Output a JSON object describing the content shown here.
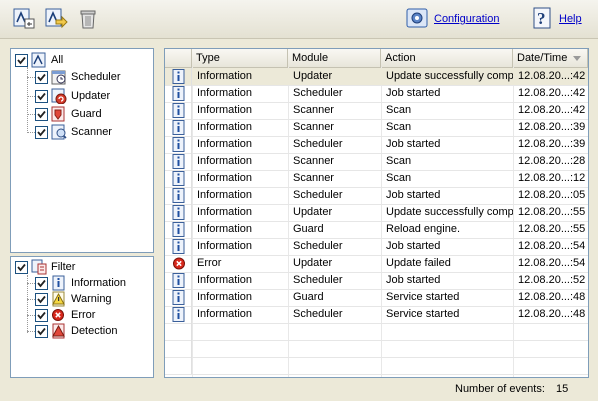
{
  "toolbar": {
    "buttons": [
      {
        "name": "export-log-icon"
      },
      {
        "name": "open-log-icon"
      },
      {
        "name": "delete-log-icon"
      }
    ],
    "configuration_label": "Configuration",
    "help_label": "Help"
  },
  "modules_tree": {
    "root_label": "All",
    "items": [
      {
        "label": "Scheduler",
        "icon": "scheduler-icon"
      },
      {
        "label": "Updater",
        "icon": "updater-icon"
      },
      {
        "label": "Guard",
        "icon": "guard-icon"
      },
      {
        "label": "Scanner",
        "icon": "scanner-icon"
      }
    ]
  },
  "filter_tree": {
    "root_label": "Filter",
    "items": [
      {
        "label": "Information",
        "icon": "information-icon"
      },
      {
        "label": "Warning",
        "icon": "warning-icon"
      },
      {
        "label": "Error",
        "icon": "error-icon"
      },
      {
        "label": "Detection",
        "icon": "detection-icon"
      }
    ]
  },
  "table": {
    "columns": [
      "Type",
      "Module",
      "Action",
      "Date/Time"
    ],
    "rows": [
      {
        "type": "Information",
        "module": "Updater",
        "action": "Update successfully compl",
        "datetime": "12.08.20...:42",
        "icon": "information"
      },
      {
        "type": "Information",
        "module": "Scheduler",
        "action": "Job started",
        "datetime": "12.08.20...:42",
        "icon": "information"
      },
      {
        "type": "Information",
        "module": "Scanner",
        "action": "Scan",
        "datetime": "12.08.20...:42",
        "icon": "information"
      },
      {
        "type": "Information",
        "module": "Scanner",
        "action": "Scan",
        "datetime": "12.08.20...:39",
        "icon": "information"
      },
      {
        "type": "Information",
        "module": "Scheduler",
        "action": "Job started",
        "datetime": "12.08.20...:39",
        "icon": "information"
      },
      {
        "type": "Information",
        "module": "Scanner",
        "action": "Scan",
        "datetime": "12.08.20...:28",
        "icon": "information"
      },
      {
        "type": "Information",
        "module": "Scanner",
        "action": "Scan",
        "datetime": "12.08.20...:12",
        "icon": "information"
      },
      {
        "type": "Information",
        "module": "Scheduler",
        "action": "Job started",
        "datetime": "12.08.20...:05",
        "icon": "information"
      },
      {
        "type": "Information",
        "module": "Updater",
        "action": "Update successfully compl",
        "datetime": "12.08.20...:55",
        "icon": "information"
      },
      {
        "type": "Information",
        "module": "Guard",
        "action": "Reload engine.",
        "datetime": "12.08.20...:55",
        "icon": "information"
      },
      {
        "type": "Information",
        "module": "Scheduler",
        "action": "Job started",
        "datetime": "12.08.20...:54",
        "icon": "information"
      },
      {
        "type": "Error",
        "module": "Updater",
        "action": "Update failed",
        "datetime": "12.08.20...:54",
        "icon": "error"
      },
      {
        "type": "Information",
        "module": "Scheduler",
        "action": "Job started",
        "datetime": "12.08.20...:52",
        "icon": "information"
      },
      {
        "type": "Information",
        "module": "Guard",
        "action": "Service started",
        "datetime": "12.08.20...:48",
        "icon": "information"
      },
      {
        "type": "Information",
        "module": "Scheduler",
        "action": "Service started",
        "datetime": "12.08.20...:48",
        "icon": "information"
      }
    ]
  },
  "status": {
    "events_label": "Number of events:",
    "events_count": "15"
  }
}
